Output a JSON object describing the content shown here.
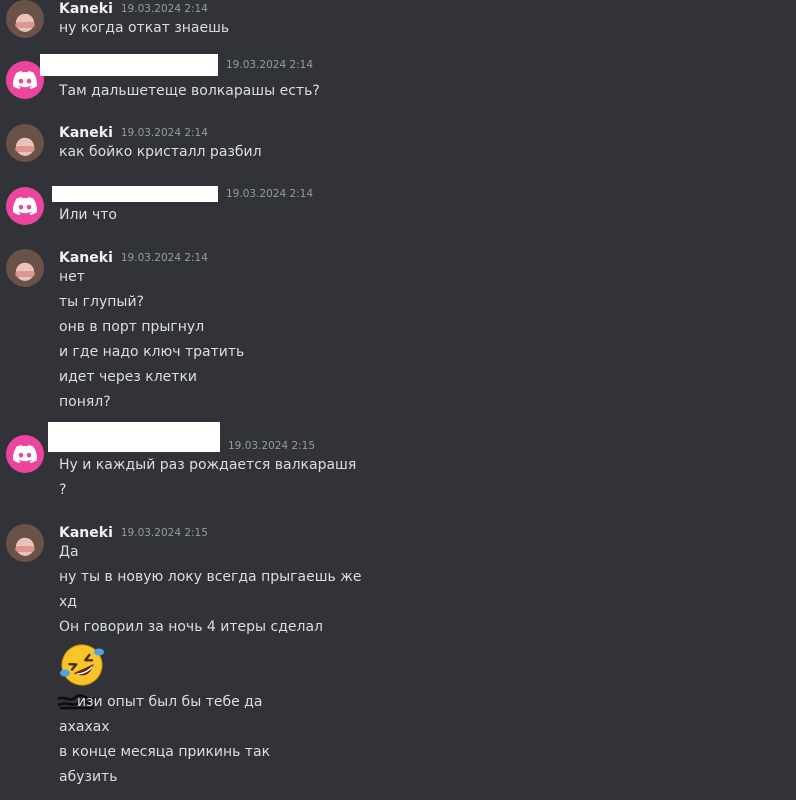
{
  "messages": [
    {
      "author": "Kaneki",
      "time": "19.03.2024 2:14",
      "avatar": "user-avatar",
      "lines": [
        "ну когда откат знаешь"
      ]
    },
    {
      "author": "",
      "time": "19.03.2024 2:14",
      "avatar": "discord-icon",
      "lines": [
        "Там дальшетеще волкарашы есть?"
      ]
    },
    {
      "author": "Kaneki",
      "time": "19.03.2024 2:14",
      "avatar": "user-avatar",
      "lines": [
        "как бойко кристалл разбил"
      ]
    },
    {
      "author": "",
      "time": "19.03.2024 2:14",
      "avatar": "discord-icon",
      "lines": [
        "Или что"
      ]
    },
    {
      "author": "Kaneki",
      "time": "19.03.2024 2:14",
      "avatar": "user-avatar",
      "lines": [
        "нет",
        "ты глупый?",
        "онв в порт прыгнул",
        "и где надо ключ тратить",
        "идет через клетки",
        "понял?"
      ]
    },
    {
      "author": "",
      "time": "19.03.2024 2:15",
      "avatar": "discord-icon",
      "lines": [
        "Ну и каждый раз рождается валкарашя",
        "?"
      ]
    },
    {
      "author": "Kaneki",
      "time": "19.03.2024 2:15",
      "avatar": "user-avatar",
      "lines": [
        "Да",
        "ну ты в новую локу всегда прыгаешь же",
        "хд",
        "Он говорил за ночь 4 итеры сделал",
        "",
        "изи опыт был бы тебе да",
        "ахахах",
        "в конце месяца прикинь так",
        "абузить"
      ]
    }
  ],
  "emoji": "rolling-on-floor-laughing-icon",
  "colors": {
    "background": "#313338",
    "discord_brand": "#eb459e",
    "text": "#dbdee1",
    "username": "#f2f3f5",
    "timestamp": "#949ba4"
  }
}
